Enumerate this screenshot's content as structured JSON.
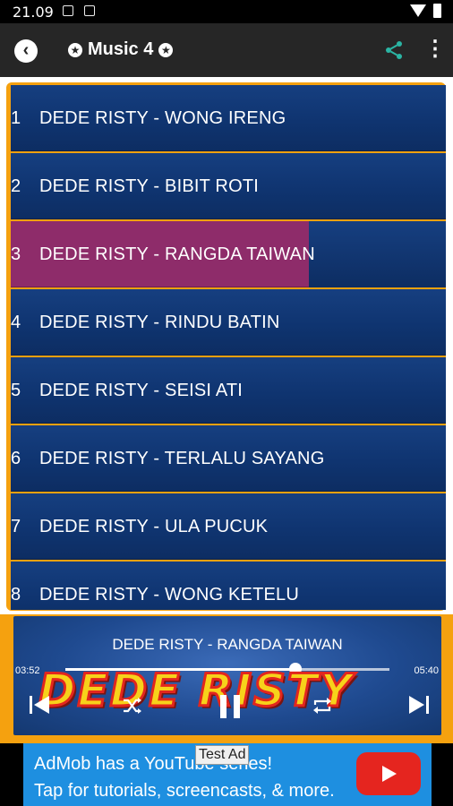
{
  "status_bar": {
    "time": "21.09",
    "icons": [
      "image-icon",
      "a-icon",
      "wifi-icon",
      "battery-icon"
    ]
  },
  "toolbar": {
    "title": "Music 4",
    "icons": [
      "back-icon",
      "star-icon",
      "share-icon",
      "more-vert-icon"
    ]
  },
  "playlist": {
    "items": [
      {
        "number": "1",
        "title": "DEDE RISTY - WONG IRENG"
      },
      {
        "number": "2",
        "title": "DEDE RISTY - BIBIT ROTI"
      },
      {
        "number": "3",
        "title": "DEDE RISTY - RANGDA TAIWAN",
        "active": true
      },
      {
        "number": "4",
        "title": "DEDE RISTY - RINDU BATIN"
      },
      {
        "number": "5",
        "title": "DEDE RISTY - SEISI ATI"
      },
      {
        "number": "6",
        "title": "DEDE RISTY - TERLALU SAYANG"
      },
      {
        "number": "7",
        "title": "DEDE RISTY - ULA PUCUK"
      },
      {
        "number": "8",
        "title": "DEDE RISTY - WONG KETELU"
      }
    ]
  },
  "player": {
    "now_playing": "DEDE RISTY - RANGDA TAIWAN",
    "elapsed": "03:52",
    "total": "05:40",
    "progress": 0.71,
    "banner_text": "DEDE RISTY",
    "controls": [
      "previous-icon",
      "shuffle-icon",
      "pause-icon",
      "repeat-icon",
      "next-icon"
    ]
  },
  "ad": {
    "badge": "Test Ad",
    "line1": "AdMob has a YouTube series!",
    "line2": "Tap for tutorials, screencasts, & more."
  },
  "colors": {
    "frame_orange": "#f5a10f",
    "row_blue": "#123a78",
    "active_row": "#8e2c6a",
    "toolbar": "#262626",
    "share_teal": "#2bb5a4",
    "ad_blue": "#1e8fe0",
    "youtube_red": "#e5251f"
  }
}
